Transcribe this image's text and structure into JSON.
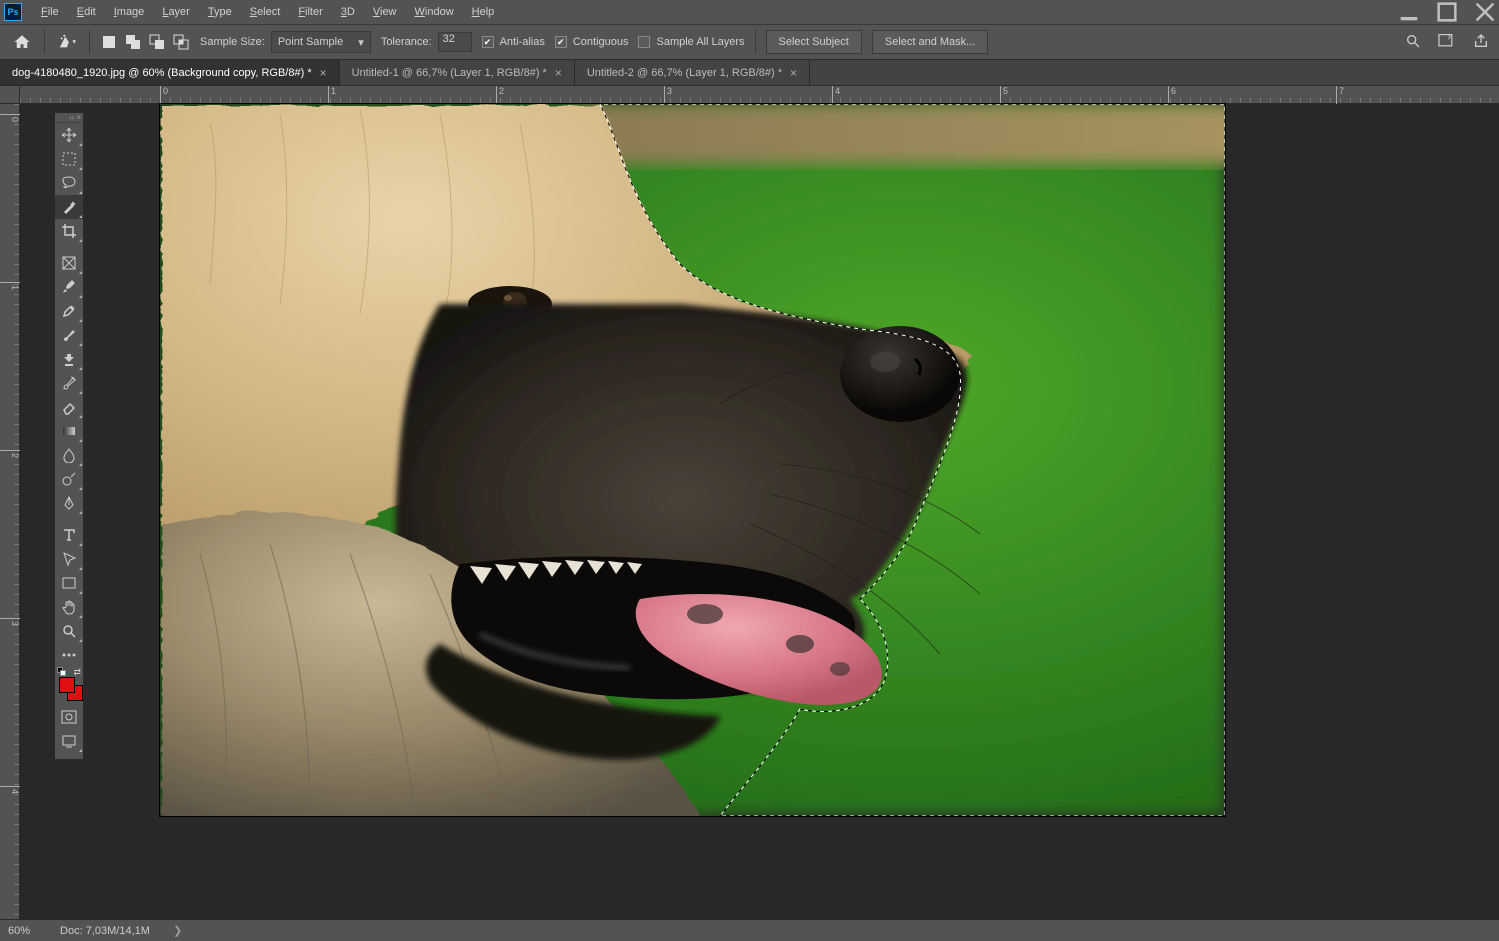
{
  "menu": {
    "items": [
      "File",
      "Edit",
      "Image",
      "Layer",
      "Type",
      "Select",
      "Filter",
      "3D",
      "View",
      "Window",
      "Help"
    ]
  },
  "options": {
    "sample_size_label": "Sample Size:",
    "sample_size_value": "Point Sample",
    "tolerance_label": "Tolerance:",
    "tolerance_value": "32",
    "anti_alias": "Anti-alias",
    "contiguous": "Contiguous",
    "sample_all": "Sample All Layers",
    "select_subject": "Select Subject",
    "select_mask": "Select and Mask..."
  },
  "tabs": [
    {
      "label": "dog-4180480_1920.jpg @ 60% (Background copy, RGB/8#) *",
      "active": true
    },
    {
      "label": "Untitled-1 @ 66,7% (Layer 1, RGB/8#) *",
      "active": false
    },
    {
      "label": "Untitled-2 @ 66,7% (Layer 1, RGB/8#) *",
      "active": false
    }
  ],
  "ruler_h": [
    "0",
    "1",
    "2",
    "3",
    "4",
    "5",
    "6",
    "7"
  ],
  "ruler_v": [
    "0",
    "1",
    "2",
    "3",
    "4"
  ],
  "status": {
    "zoom": "60%",
    "doc": "Doc: 7,03M/14,1M"
  },
  "tools": [
    "move",
    "marquee",
    "lasso",
    "magic-wand",
    "crop",
    "frame",
    "eyedropper",
    "healing",
    "brush",
    "clone",
    "history-brush",
    "eraser",
    "gradient",
    "blur",
    "dodge",
    "pen",
    "type",
    "path-select",
    "rectangle",
    "hand",
    "zoom"
  ],
  "colors": {
    "foreground": "#e01010",
    "background": "#e01010"
  }
}
